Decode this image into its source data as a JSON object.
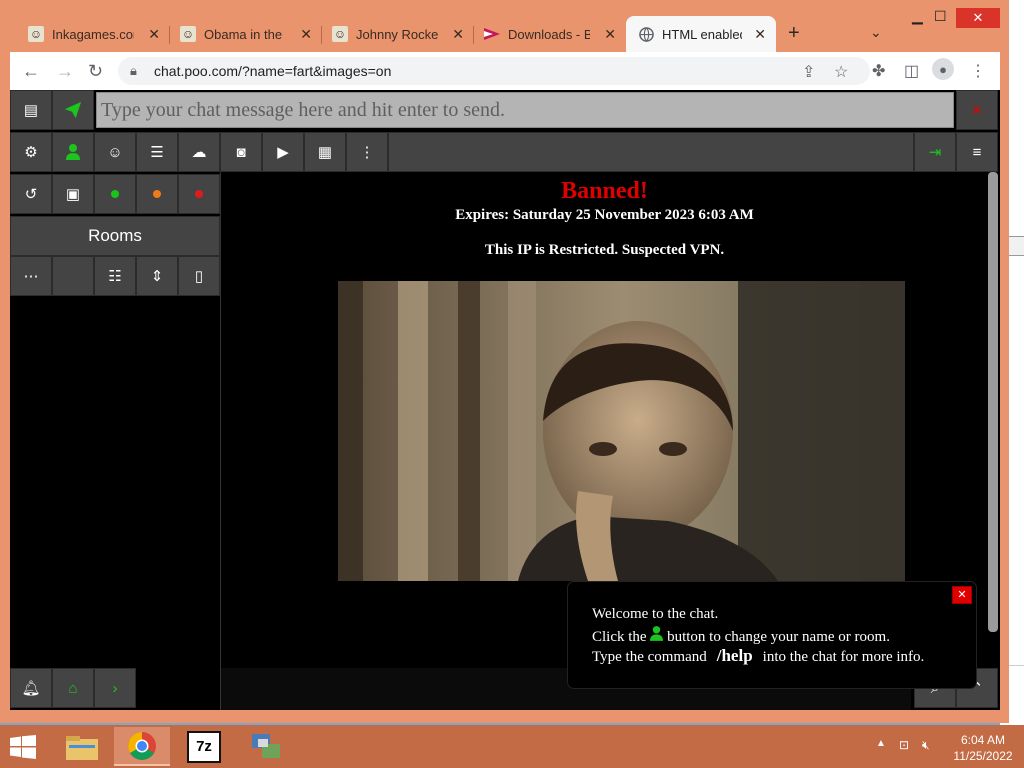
{
  "browser": {
    "tabs": [
      {
        "title": "Inkagames.com",
        "active": false
      },
      {
        "title": "Obama in the Da",
        "active": false
      },
      {
        "title": "Johnny Rocketfi",
        "active": false
      },
      {
        "title": "Downloads - Bla",
        "active": false
      },
      {
        "title": "HTML enabled c",
        "active": true
      }
    ],
    "new_tab": "+",
    "url": "chat.poo.com/?name=fart&images=on"
  },
  "chat": {
    "message_placeholder": "Type your chat message here and hit enter to send.",
    "rooms_label": "Rooms",
    "banned_title": "Banned!",
    "expires": "Expires: Saturday 25 November 2023 6:03 AM",
    "restriction": "This IP is Restricted. Suspected VPN.",
    "welcome": {
      "line1": "Welcome to the chat.",
      "line2_pre": "Click the",
      "line2_post": "button to change your name or room.",
      "line3_pre": "Type the command",
      "command": "/help",
      "line3_post": "into the chat for more info."
    },
    "status_colors": {
      "green": "#19c419",
      "orange": "#f07a1a",
      "red": "#e01b1b"
    }
  },
  "taskbar": {
    "time": "6:04 AM",
    "date": "11/25/2022",
    "seven_zip": "7z"
  }
}
